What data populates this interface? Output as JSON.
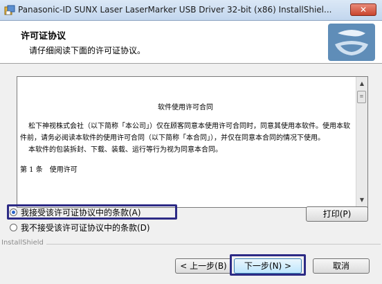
{
  "window": {
    "title": "Panasonic-ID SUNX Laser LaserMarker USB Driver 32-bit (x86) InstallShiel...",
    "close_label": "✕"
  },
  "header": {
    "title": "许可证协议",
    "subtitle": "请仔细阅读下面的许可证协议。"
  },
  "license": {
    "heading": "软件使用许可合同",
    "paragraphs": [
      "松下神视株式会社（以下简称「本公司」）仅在顾客同意本使用许可合同时，同意其使用本软件。使用本软件前，请务必阅读本软件的使用许可合同（以下简称「本合同」），并仅在同意本合同的情况下使用。",
      "本软件的包装拆封、下载、装载、运行等行为视为同意本合同。"
    ],
    "article": "第 1 条　使用许可"
  },
  "options": {
    "accept": "我接受该许可证协议中的条款(A)",
    "decline": "我不接受该许可证协议中的条款(D)",
    "accept_selected": true
  },
  "buttons": {
    "print": "打印(P)",
    "back": "< 上一步(B)",
    "next": "下一步(N) >",
    "cancel": "取消"
  },
  "footer": {
    "brand": "InstallShield"
  }
}
